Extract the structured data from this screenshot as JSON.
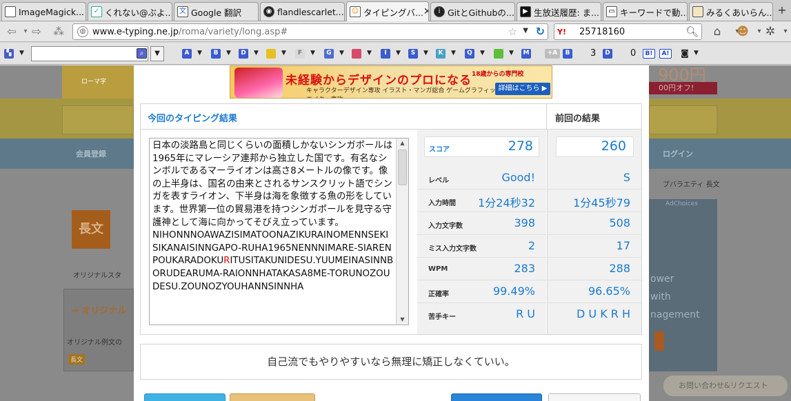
{
  "tabs": [
    {
      "label": "ImageMagick...",
      "icon": "document-icon"
    },
    {
      "label": "くれない@ぶよ...",
      "icon": "twitter-bird-icon"
    },
    {
      "label": "Google 翻訳",
      "icon": "google-translate-icon"
    },
    {
      "label": "flandlescarlet...",
      "icon": "github-icon"
    },
    {
      "label": "タイピングバ...",
      "icon": "etyping-icon",
      "active": true
    },
    {
      "label": "GitとGithubの...",
      "icon": "site-icon"
    },
    {
      "label": "生放送履歴: ま...",
      "icon": "nico-icon"
    },
    {
      "label": "キーワードで動...",
      "icon": "tv-icon"
    },
    {
      "label": "みるくあいらん...",
      "icon": "page-icon"
    }
  ],
  "address": {
    "host": "www.e-typing.ne.jp",
    "path": "/roma/variety/long.asp#"
  },
  "search": {
    "engine": "Y!",
    "value": "25718160"
  },
  "toolbar2": {
    "buttons": [
      "A",
      "B",
      "D",
      "",
      "F",
      "G",
      "",
      "I",
      "S",
      "K",
      "Q",
      "",
      "M"
    ],
    "tagA": "+A",
    "tagB": "B",
    "num1": "3",
    "tagD": "D",
    "num2": "0",
    "tagB2": "B!",
    "tagA2": "A!"
  },
  "modal": {
    "ad": {
      "headline": "未経験からデザインのプロになる",
      "sub": "キャラクターデザイン専攻 イラスト・マンガ総合 ゲームグラフィック専攻 マンガクリエイター専攻",
      "age": "18歳からの専門校",
      "button": "詳細はこちら ▶"
    },
    "result_title": "今回のタイピング結果",
    "prev_title": "前回の結果",
    "text_jp": "日本の淡路島と同じくらいの面積しかないシンガポールは1965年にマレーシア連邦から独立した国です。有名なシンボルであるマーライオンは高さ8メートルの像です。像の上半身は、国名の由来とされるサンスクリット語でシンガを表すライオン、下半身は海を象徴する魚の形をしています。世界第一位の貿易港を持つシンガポールを見守る守護神として海に向かってそびえ立っています。",
    "text_romaji_before": "NIHONNNOAWAZISIMATOONAZIKURAINOMENNSEKISIKANAISINNGAPO-RUHA1965NENNNIMARE-SIARENPOUKARADOKU",
    "text_romaji_miss": "R",
    "text_romaji_after": "ITUSITAKUNIDESU.YUUMEINASINNBORUDEARUMA-RAIONNHATAKASA8ME-TORUNOZOUDESU.ZOUNOZYOUHANNSINNHA",
    "stats": [
      {
        "label": "スコア",
        "value": "278"
      },
      {
        "label": "レベル",
        "value": "Good!"
      },
      {
        "label": "入力時間",
        "value": "1分24秒32"
      },
      {
        "label": "入力文字数",
        "value": "398"
      },
      {
        "label": "ミス入力文字数",
        "value": "2"
      },
      {
        "label": "WPM",
        "value": "283"
      },
      {
        "label": "正確率",
        "value": "99.49%"
      },
      {
        "label": "苦手キー",
        "value": "R U"
      }
    ],
    "prev": [
      "260",
      "S",
      "1分45秒79",
      "508",
      "17",
      "288",
      "96.65%",
      "D U K R H"
    ],
    "comment": "自己流でもやりやすいなら無理に矯正しなくていい。"
  },
  "background": {
    "nav1": "会員登録",
    "nav2": "ログイン",
    "price": "900円",
    "price_off": "00円オフ!",
    "adchoices": "AdChoices",
    "badge": "長文",
    "orig_label": "オリジナルスタ",
    "orig_head": "オリジナル",
    "orig_text": "オリジナル例文の",
    "small_badge": "長文",
    "variety": "ブバラエティ 長文",
    "promo1": "ower",
    "promo2": "with",
    "promo3": "nagement",
    "contact": "お問い合わせ&リクエスト",
    "logo_sub": "ローマ字"
  },
  "colors": {
    "accent": "#1a7ad0",
    "miss": "#d11111"
  }
}
